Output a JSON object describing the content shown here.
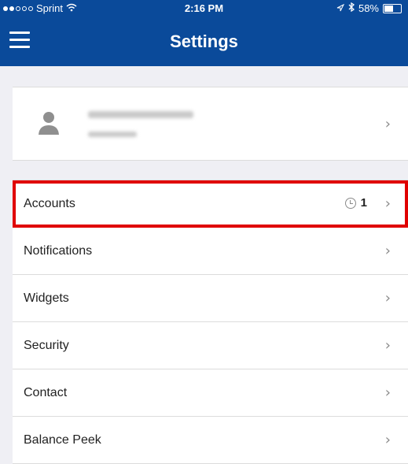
{
  "status_bar": {
    "carrier": "Sprint",
    "time": "2:16 PM",
    "battery": "58%"
  },
  "header": {
    "title": "Settings"
  },
  "settings_list": [
    {
      "label": "Accounts",
      "badge_count": "1"
    },
    {
      "label": "Notifications"
    },
    {
      "label": "Widgets"
    },
    {
      "label": "Security"
    },
    {
      "label": "Contact"
    },
    {
      "label": "Balance Peek"
    }
  ],
  "colors": {
    "nav_bg": "#0a4a9a",
    "page_bg": "#efeff4",
    "highlight": "#e00000"
  }
}
